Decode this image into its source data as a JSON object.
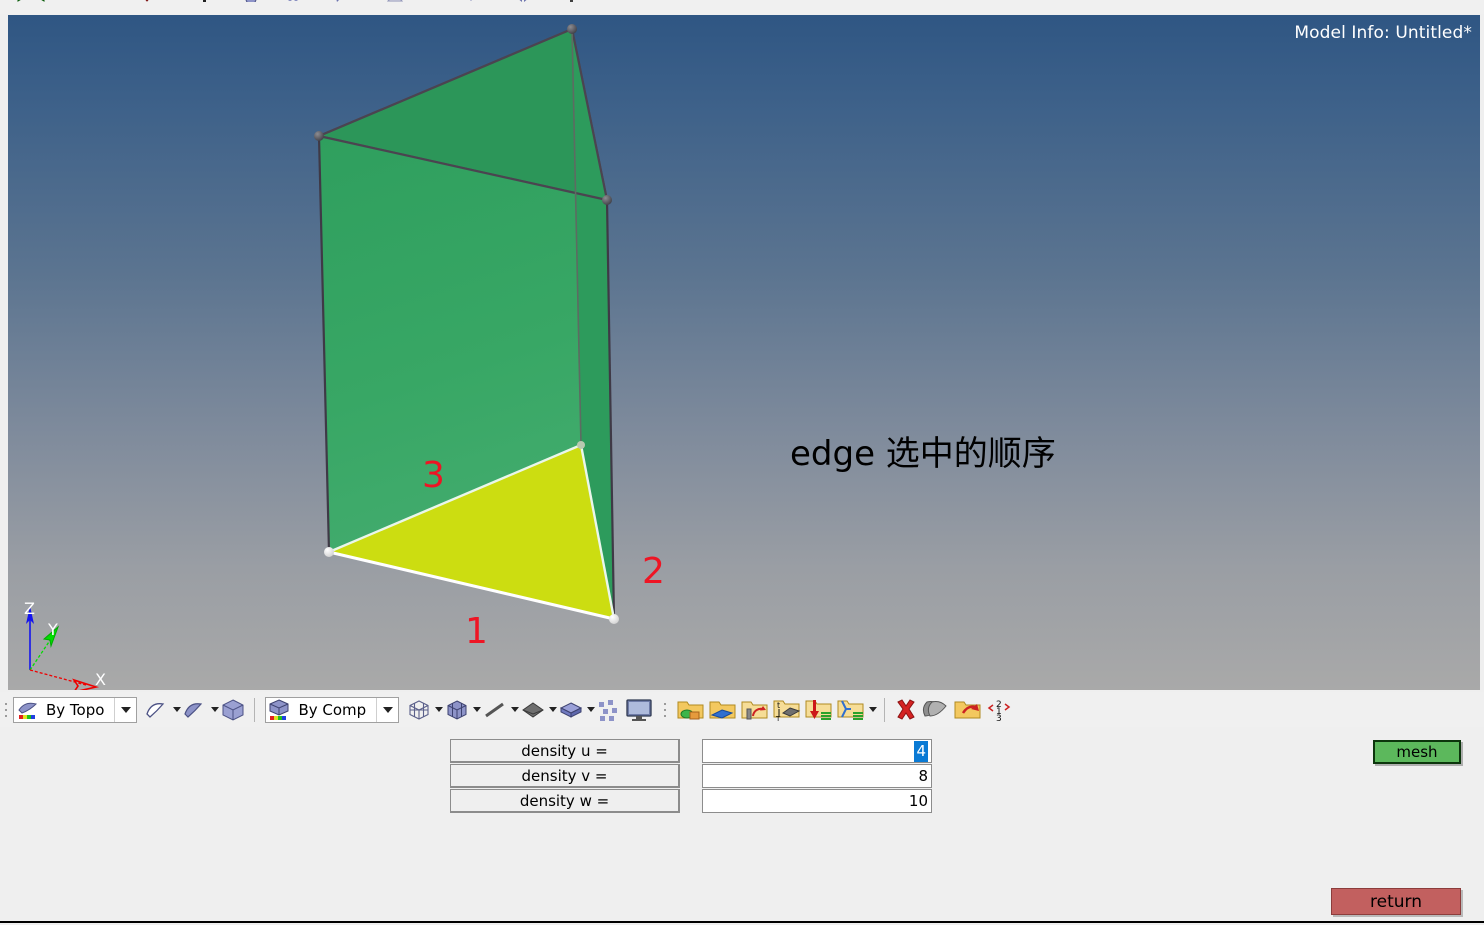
{
  "window": {
    "model_info": "Model Info: Untitled*"
  },
  "viewport": {
    "annotation": "edge 选中的顺序",
    "edge_labels": [
      "1",
      "2",
      "3"
    ],
    "axes": [
      {
        "name": "z-axis",
        "label": "Z",
        "color": "#0000ff"
      },
      {
        "name": "y-axis",
        "label": "Y",
        "color": "#00dd00"
      },
      {
        "name": "x-axis",
        "label": "X",
        "color": "#ff0000"
      }
    ],
    "colors": {
      "background_top": "#2f5683",
      "background_bottom": "#a9a9a9",
      "solid_face": "#34a060",
      "selected_face": "#ccdd11",
      "selected_edge": "#ffffff",
      "edge_label": "#ee1524",
      "wire_edge": "#4b4450"
    }
  },
  "toolbar": {
    "topo_combo": {
      "label": "By Topo",
      "icon": "topo-surface-icon"
    },
    "comp_combo": {
      "label": "By Comp",
      "icon": "component-cube-icon"
    },
    "buttons": [
      {
        "name": "surface-outline-icon"
      },
      {
        "name": "surface-filled-icon"
      },
      {
        "name": "solid-cube-icon"
      },
      {
        "name": "wire-cube-icon"
      },
      {
        "name": "mesh-cube-icon"
      },
      {
        "name": "line-element-icon"
      },
      {
        "name": "shell-element-icon"
      },
      {
        "name": "solid-element-icon"
      },
      {
        "name": "scatter-elements-icon"
      },
      {
        "name": "display-monitor-icon"
      },
      {
        "name": "folder-material-icon"
      },
      {
        "name": "folder-property-icon"
      },
      {
        "name": "folder-boundary-icon"
      },
      {
        "name": "folder-thickness-icon"
      },
      {
        "name": "folder-load-icon"
      },
      {
        "name": "folder-constraint-icon"
      },
      {
        "name": "delete-cross-icon"
      },
      {
        "name": "layers-stack-icon"
      },
      {
        "name": "folder-import-icon"
      },
      {
        "name": "renumber-123-icon"
      }
    ]
  },
  "density_panel": {
    "rows": [
      {
        "label": "density u = ",
        "value": "4",
        "selected": true
      },
      {
        "label": "density v = ",
        "value": "8",
        "selected": false
      },
      {
        "label": "density w = ",
        "value": "10",
        "selected": false
      }
    ]
  },
  "actions": {
    "mesh_label": "mesh",
    "mesh_color": "#5cb85c",
    "return_label": "return",
    "return_color": "#c2605f"
  }
}
